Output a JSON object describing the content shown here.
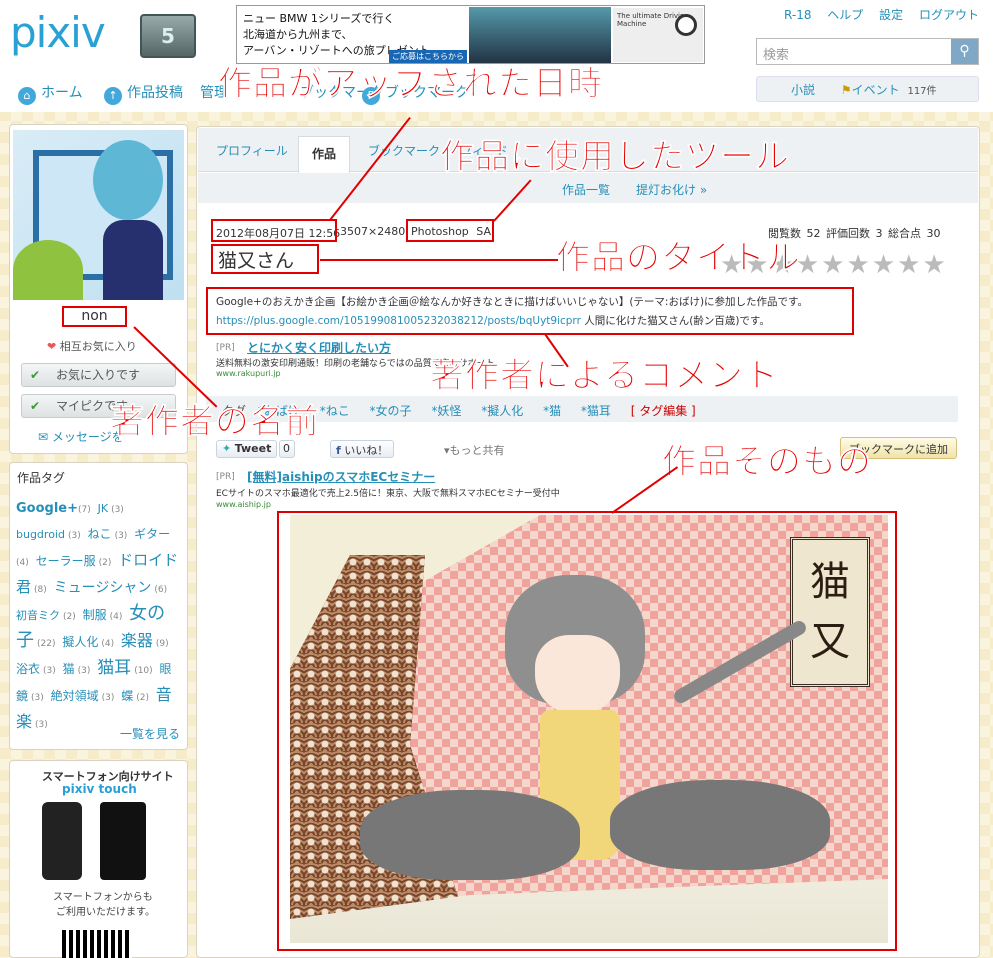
{
  "header": {
    "logo": "pixiv",
    "logo_badge": "5",
    "ad_line1": "ニュー BMW 1シリーズで行く",
    "ad_line2": "北海道から九州まで、",
    "ad_line3": "アーバン・リゾートへの旅プレゼント。",
    "ad_button": "ご応募はこちらから",
    "ad_right": "The ultimate Driving Machine",
    "toplinks": [
      "R-18",
      "ヘルプ",
      "設定",
      "ログアウト"
    ],
    "search_placeholder": "検索",
    "nav": [
      "ホーム",
      "作品投稿",
      "管理",
      "ブックマーク",
      "ブックマーク"
    ],
    "novel": "小説",
    "event": "イベント",
    "event_count": "117件"
  },
  "sidebar": {
    "username": "non",
    "mutual": "相互お気に入り",
    "fav_button": "お気に入りです",
    "mypic_button": "マイピクです",
    "message": "メッセージを",
    "tags_title": "作品タグ",
    "tags": [
      {
        "name": "Google+",
        "count": "(7)"
      },
      {
        "name": "JK",
        "count": "(3)"
      },
      {
        "name": "bugdroid",
        "count": "(3)"
      },
      {
        "name": "ねこ",
        "count": "(3)"
      },
      {
        "name": "ギター",
        "count": "(4)"
      },
      {
        "name": "セーラー服",
        "count": "(2)"
      },
      {
        "name": "ドロイド君",
        "count": "(8)"
      },
      {
        "name": "ミュージシャン",
        "count": "(6)"
      },
      {
        "name": "初音ミク",
        "count": "(2)"
      },
      {
        "name": "制服",
        "count": "(4)"
      },
      {
        "name": "女の子",
        "count": "(22)"
      },
      {
        "name": "擬人化",
        "count": "(4)"
      },
      {
        "name": "楽器",
        "count": "(9)"
      },
      {
        "name": "浴衣",
        "count": "(3)"
      },
      {
        "name": "猫",
        "count": "(3)"
      },
      {
        "name": "猫耳",
        "count": "(10)"
      },
      {
        "name": "眼鏡",
        "count": "(3)"
      },
      {
        "name": "絶対領域",
        "count": "(3)"
      },
      {
        "name": "蝶",
        "count": "(2)"
      },
      {
        "name": "音楽",
        "count": "(3)"
      }
    ],
    "tags_more": "一覧を見る",
    "sp_title": "スマートフォン向けサイト",
    "sp_name": "pixiv touch",
    "sp_text1": "スマートフォンからも",
    "sp_text2": "ご利用いただけます。"
  },
  "main": {
    "tabs": [
      "プロフィール",
      "作品",
      "ブックマーク",
      "フィード"
    ],
    "sub_links": [
      "作品一覧",
      "提灯お化け »"
    ],
    "date": "2012年08月07日 12:56",
    "size": "3507×2480",
    "tools": "Photoshop SAI",
    "stats": "閲覧数 52 評価回数 3 総合点 30",
    "title": "猫又さん",
    "caption1": "Google+のおえかき企画【お絵かき企画＠絵なんか好きなときに描けばいいじゃない】(テーマ:おばけ)に参加した作品です。",
    "caption2_link": "https://plus.google.com/105199081005232038212/posts/bqUyt9icprr",
    "caption2_text": "人間に化けた猫又さん(齢ン百歳)です。",
    "pr1_tag": "[PR]",
    "pr1_title": "とにかく安く印刷したい方",
    "pr1_desc": "送料無料の激安印刷通販！印刷の老舗ならではの品質で安心サポート",
    "pr1_url": "www.rakupuri.jp",
    "tag_label": "タグ",
    "tags": [
      "おばけ",
      "ねこ",
      "女の子",
      "妖怪",
      "擬人化",
      "猫",
      "猫耳"
    ],
    "tag_edit": "[ タグ編集 ]",
    "tweet": "Tweet",
    "tweet_count": "0",
    "like": "いいね！",
    "more_share": "もっと共有",
    "bookmark_add": "ブックマークに追加",
    "pr2_tag": "[PR]",
    "pr2_title": "[無料]aishipのスマホECセミナー",
    "pr2_desc": "ECサイトのスマホ最適化で売上2.5倍に！東京、大阪で無料スマホECセミナー受付中",
    "pr2_url": "www.aiship.jp",
    "art_title": "猫又"
  },
  "annotations": {
    "uploaded": "作品がアップされた日時",
    "tool": "作品に使用したツール",
    "title": "作品のタイトル",
    "comment": "著作者によるコメント",
    "author": "著作者の名前",
    "work": "作品そのもの"
  }
}
